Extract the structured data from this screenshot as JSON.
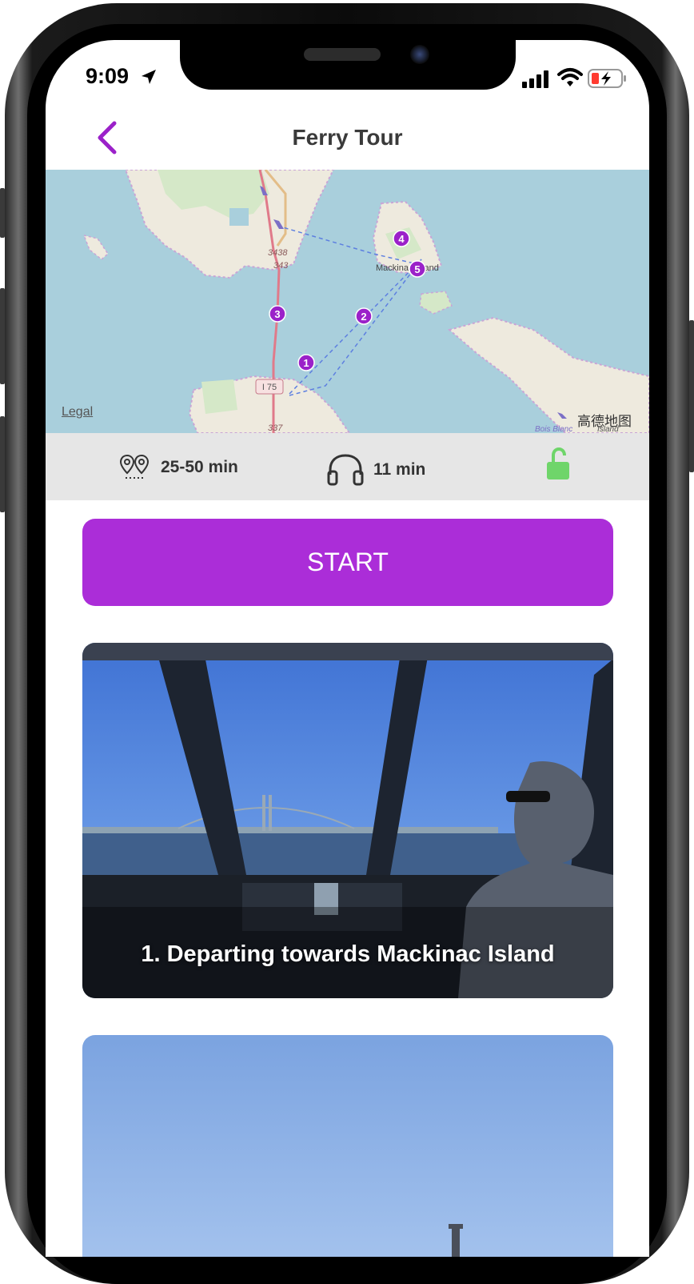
{
  "status_bar": {
    "time": "9:09"
  },
  "nav": {
    "title": "Ferry Tour"
  },
  "map": {
    "legal_label": "Legal",
    "brand_label": "高德地图",
    "labels": {
      "island": "Mackinac Island",
      "bois_blanc": "Bois Blanc",
      "island_small": "Island",
      "route_3438": "3438",
      "route_343": "343",
      "route_i75": "I 75",
      "route_337": "337"
    },
    "stops": [
      "1",
      "2",
      "3",
      "4",
      "5"
    ],
    "marker_color": "#9b21c9"
  },
  "info": {
    "walk_duration": "25-50 min",
    "audio_duration": "11 min",
    "lock_state": "unlocked",
    "lock_color": "#6fd56a"
  },
  "start_button": {
    "label": "START",
    "color": "#ab2dd8"
  },
  "stops": [
    {
      "title": "1. Departing towards Mackinac Island"
    },
    {
      "title": ""
    }
  ],
  "accent_color": "#9b21c9"
}
